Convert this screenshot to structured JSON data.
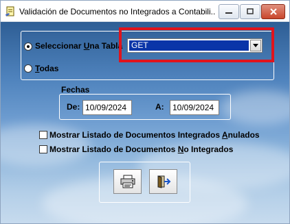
{
  "window": {
    "title": "Validación de Documentos no Integrados a Contabili..."
  },
  "selection": {
    "option_table_prefix": "Seleccionar ",
    "option_table_mnemonic": "U",
    "option_table_suffix": "na Tabla",
    "option_all_mnemonic": "T",
    "option_all_suffix": "odas",
    "selected_option": "Seleccionar Una Tabla",
    "table_value": "GET"
  },
  "dates": {
    "group_label": "Fechas",
    "from_label": "De:",
    "from_value": "10/09/2024",
    "to_label": "A:",
    "to_value": "10/09/2024"
  },
  "options": {
    "show_annulled_prefix": "Mostrar Listado de Documentos Integrados ",
    "show_annulled_mnemonic": "A",
    "show_annulled_suffix": "nulados",
    "show_annulled_checked": false,
    "show_not_integrated_prefix": "Mostrar Listado de Documentos ",
    "show_not_integrated_mnemonic": "N",
    "show_not_integrated_suffix": "o Integrados",
    "show_not_integrated_checked": false
  },
  "icons": {
    "app": "form-document-icon",
    "print": "printer-icon",
    "exit": "exit-door-icon"
  },
  "colors": {
    "selection_highlight": "#0a35a8",
    "annotation_box": "#e0141c",
    "close_button": "#c9462c"
  }
}
